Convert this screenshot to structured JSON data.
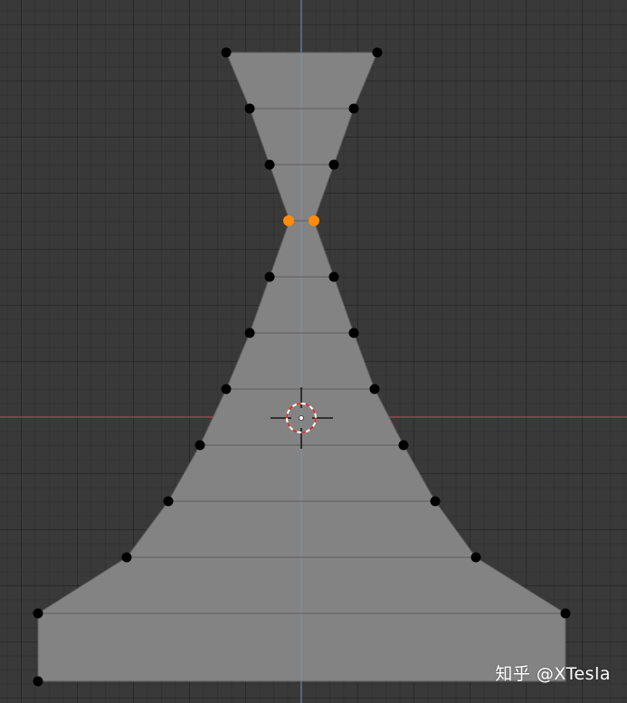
{
  "viewport": {
    "watermark": "知乎 @XTesla",
    "colors": {
      "background": "#393939",
      "face": "#838383",
      "edge": "#5e5e5e",
      "vertex": "#000000",
      "selected_vertex": "#ff8c0a",
      "x_axis": "#b54a55",
      "y_axis": "#6f8fb0",
      "cursor_red": "#d33030",
      "cursor_white": "#ffffff"
    },
    "icons": [
      "3d-cursor-icon"
    ]
  }
}
